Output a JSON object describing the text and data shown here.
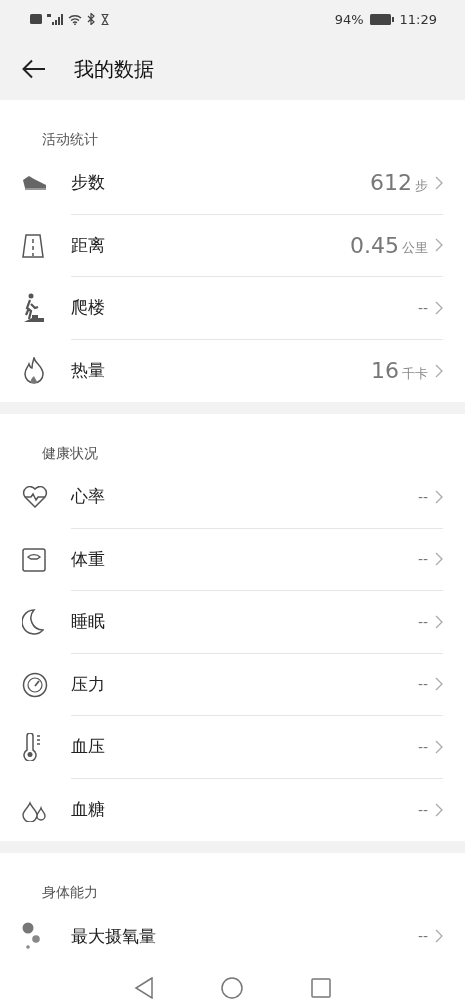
{
  "status_bar": {
    "battery": "94%",
    "time": "11:29"
  },
  "header": {
    "title": "我的数据"
  },
  "sections": [
    {
      "title": "活动统计",
      "items": [
        {
          "kind": "steps",
          "label": "步数",
          "value": "612",
          "unit": "步"
        },
        {
          "kind": "distance",
          "label": "距离",
          "value": "0.45",
          "unit": "公里"
        },
        {
          "kind": "climb",
          "label": "爬楼",
          "value": "--"
        },
        {
          "kind": "calories",
          "label": "热量",
          "value": "16",
          "unit": "千卡"
        }
      ]
    },
    {
      "title": "健康状况",
      "items": [
        {
          "kind": "heart",
          "label": "心率",
          "value": "--"
        },
        {
          "kind": "weight",
          "label": "体重",
          "value": "--"
        },
        {
          "kind": "sleep",
          "label": "睡眠",
          "value": "--"
        },
        {
          "kind": "stress",
          "label": "压力",
          "value": "--"
        },
        {
          "kind": "pressure",
          "label": "血压",
          "value": "--"
        },
        {
          "kind": "glucose",
          "label": "血糖",
          "value": "--"
        }
      ]
    },
    {
      "title": "身体能力",
      "items": [
        {
          "kind": "vo2",
          "label": "最大摄氧量",
          "value": "--"
        }
      ]
    }
  ]
}
